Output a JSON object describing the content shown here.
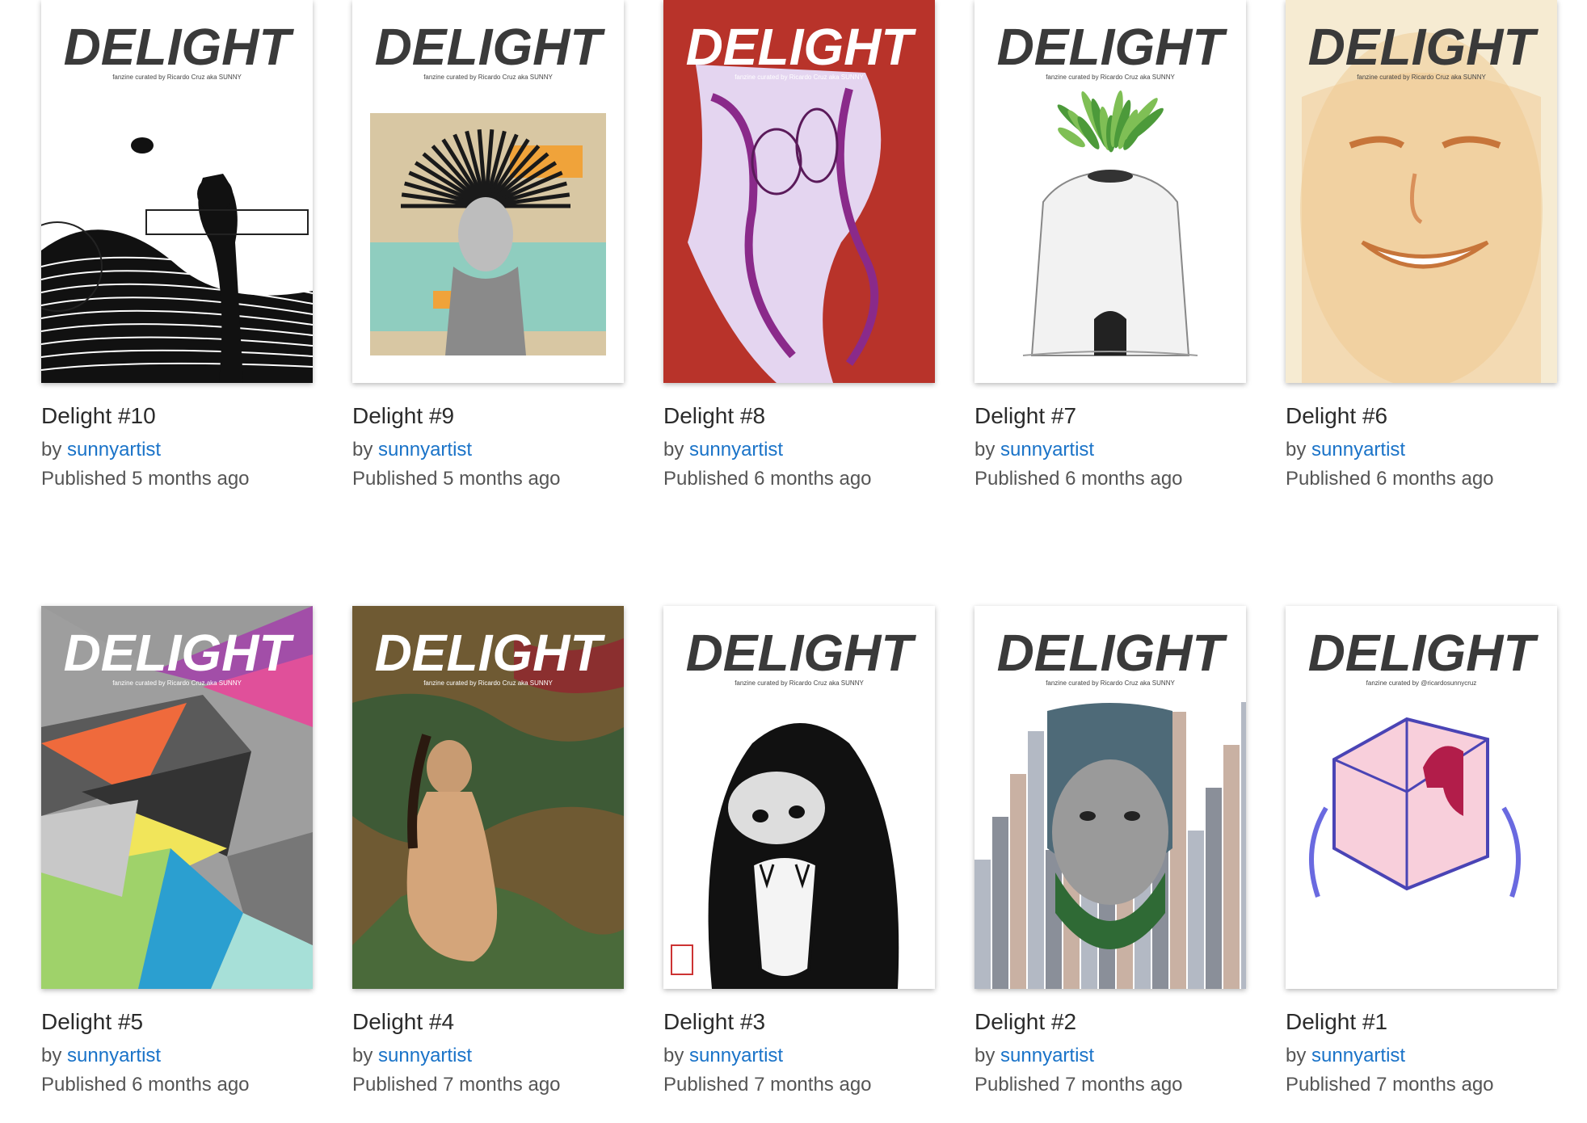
{
  "issues": [
    {
      "title": "Delight #10",
      "by": "by",
      "author": "sunnyartist",
      "published": "Published 5 months ago",
      "cover_masthead": "DELIGHT",
      "cover_subtitle": "fanzine curated by Ricardo Cruz aka SUNNY",
      "cover_theme": "ink-woman",
      "cover_bg": "#ffffff"
    },
    {
      "title": "Delight #9",
      "by": "by",
      "author": "sunnyartist",
      "published": "Published 5 months ago",
      "cover_masthead": "DELIGHT",
      "cover_subtitle": "fanzine curated by Ricardo Cruz aka SUNNY",
      "cover_theme": "collage-headdress",
      "cover_bg": "#ffffff"
    },
    {
      "title": "Delight #8",
      "by": "by",
      "author": "sunnyartist",
      "published": "Published 6 months ago",
      "cover_masthead": "DELIGHT",
      "cover_subtitle": "fanzine curated by Ricardo Cruz aka SUNNY",
      "cover_theme": "red-abstract",
      "cover_bg": "#c0392b"
    },
    {
      "title": "Delight #7",
      "by": "by",
      "author": "sunnyartist",
      "published": "Published 6 months ago",
      "cover_masthead": "DELIGHT",
      "cover_subtitle": "fanzine curated by Ricardo Cruz aka SUNNY",
      "cover_theme": "plant-head",
      "cover_bg": "#ffffff"
    },
    {
      "title": "Delight #6",
      "by": "by",
      "author": "sunnyartist",
      "published": "Published 6 months ago",
      "cover_masthead": "DELIGHT",
      "cover_subtitle": "fanzine curated by Ricardo Cruz aka SUNNY",
      "cover_theme": "watercolor-face",
      "cover_bg": "#f6ebd2"
    },
    {
      "title": "Delight #5",
      "by": "by",
      "author": "sunnyartist",
      "published": "Published 6 months ago",
      "cover_masthead": "DELIGHT",
      "cover_subtitle": "fanzine curated by Ricardo Cruz aka SUNNY",
      "cover_theme": "geometric",
      "cover_bg": "#9e9e9e"
    },
    {
      "title": "Delight #4",
      "by": "by",
      "author": "sunnyartist",
      "published": "Published 7 months ago",
      "cover_masthead": "DELIGHT",
      "cover_subtitle": "fanzine curated by Ricardo Cruz aka SUNNY",
      "cover_theme": "camo-figure",
      "cover_bg": "#7a6a3a"
    },
    {
      "title": "Delight #3",
      "by": "by",
      "author": "sunnyartist",
      "published": "Published 7 months ago",
      "cover_masthead": "DELIGHT",
      "cover_subtitle": "fanzine curated by Ricardo Cruz aka SUNNY",
      "cover_theme": "gorilla",
      "cover_bg": "#ffffff"
    },
    {
      "title": "Delight #2",
      "by": "by",
      "author": "sunnyartist",
      "published": "Published 7 months ago",
      "cover_masthead": "DELIGHT",
      "cover_subtitle": "fanzine curated by Ricardo Cruz aka SUNNY",
      "cover_theme": "city-face",
      "cover_bg": "#ffffff"
    },
    {
      "title": "Delight #1",
      "by": "by",
      "author": "sunnyartist",
      "published": "Published 7 months ago",
      "cover_masthead": "DELIGHT",
      "cover_subtitle": "fanzine curated by @ricardosunnycruz",
      "cover_theme": "glass-house",
      "cover_bg": "#ffffff"
    }
  ],
  "colors": {
    "link": "#1a73c8",
    "title": "#2b2b2b",
    "meta": "#555555"
  }
}
